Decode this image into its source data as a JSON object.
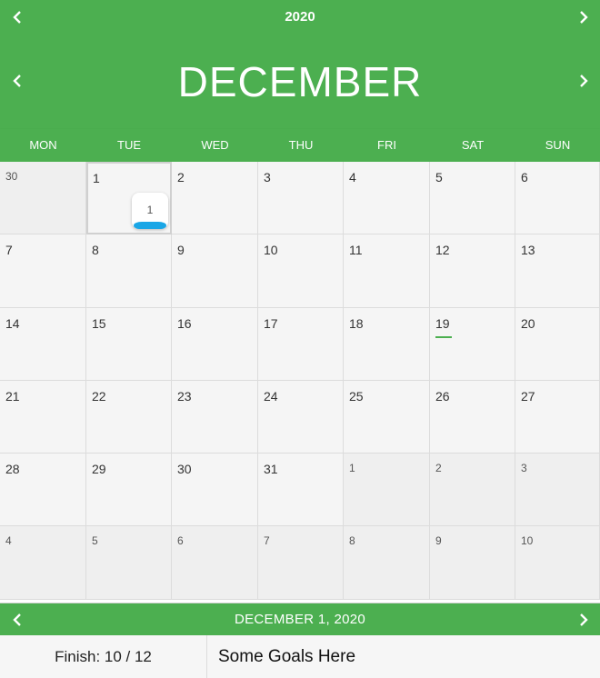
{
  "year_nav": {
    "title": "2020",
    "prev_icon": "chevron-left-icon",
    "next_icon": "chevron-right-icon"
  },
  "month_nav": {
    "title": "DECEMBER",
    "prev_icon": "chevron-left-icon",
    "next_icon": "chevron-right-icon"
  },
  "weekdays": [
    "MON",
    "TUE",
    "WED",
    "THU",
    "FRI",
    "SAT",
    "SUN"
  ],
  "weeks": [
    [
      {
        "day": "30",
        "other": true
      },
      {
        "day": "1",
        "selected": true,
        "events": "1"
      },
      {
        "day": "2"
      },
      {
        "day": "3"
      },
      {
        "day": "4"
      },
      {
        "day": "5"
      },
      {
        "day": "6"
      }
    ],
    [
      {
        "day": "7"
      },
      {
        "day": "8"
      },
      {
        "day": "9"
      },
      {
        "day": "10"
      },
      {
        "day": "11"
      },
      {
        "day": "12"
      },
      {
        "day": "13"
      }
    ],
    [
      {
        "day": "14"
      },
      {
        "day": "15"
      },
      {
        "day": "16"
      },
      {
        "day": "17"
      },
      {
        "day": "18"
      },
      {
        "day": "19",
        "today": true
      },
      {
        "day": "20"
      }
    ],
    [
      {
        "day": "21"
      },
      {
        "day": "22"
      },
      {
        "day": "23"
      },
      {
        "day": "24"
      },
      {
        "day": "25"
      },
      {
        "day": "26"
      },
      {
        "day": "27"
      }
    ],
    [
      {
        "day": "28"
      },
      {
        "day": "29"
      },
      {
        "day": "30"
      },
      {
        "day": "31"
      },
      {
        "day": "1",
        "other": true
      },
      {
        "day": "2",
        "other": true
      },
      {
        "day": "3",
        "other": true
      }
    ],
    [
      {
        "day": "4",
        "other": true
      },
      {
        "day": "5",
        "other": true
      },
      {
        "day": "6",
        "other": true
      },
      {
        "day": "7",
        "other": true
      },
      {
        "day": "8",
        "other": true
      },
      {
        "day": "9",
        "other": true
      },
      {
        "day": "10",
        "other": true
      }
    ]
  ],
  "date_nav": {
    "title": "DECEMBER 1, 2020",
    "prev_icon": "chevron-left-icon",
    "next_icon": "chevron-right-icon"
  },
  "footer": {
    "finish": "Finish: 10 / 12",
    "goals": "Some Goals Here"
  },
  "colors": {
    "accent": "#4caf50",
    "event_fill": "#1aa6e6",
    "cell_bg": "#f5f5f5",
    "other_month_bg": "#efefef"
  }
}
